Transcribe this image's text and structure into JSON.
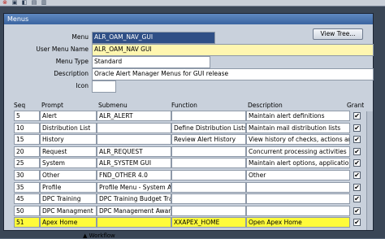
{
  "window": {
    "title": "Menus"
  },
  "toolbar": {
    "icons": [
      "close-icon",
      "save-icon",
      "nav-icon",
      "folder-icon",
      "print-icon"
    ]
  },
  "form": {
    "menu_label": "Menu",
    "menu_value": "ALR_OAM_NAV_GUI",
    "user_menu_name_label": "User Menu Name",
    "user_menu_name_value": "ALR_OAM_NAV GUI",
    "menu_type_label": "Menu Type",
    "menu_type_value": "Standard",
    "description_label": "Description",
    "description_value": "Oracle Alert Manager Menus for GUI release",
    "icon_label": "Icon",
    "icon_value": ""
  },
  "view_tree_button": "View Tree...",
  "table": {
    "headers": {
      "seq": "Seq",
      "prompt": "Prompt",
      "submenu": "Submenu",
      "function": "Function",
      "description": "Description",
      "grant": "Grant"
    },
    "rows": [
      {
        "seq": "5",
        "prompt": "Alert",
        "submenu": "ALR_ALERT",
        "function": "",
        "description": "Maintain alert definitions",
        "grant": true
      },
      {
        "seq": "10",
        "prompt": "Distribution List",
        "submenu": "",
        "function": "Define Distribution Lists",
        "description": "Maintain mail distribution lists",
        "grant": true
      },
      {
        "seq": "15",
        "prompt": "History",
        "submenu": "",
        "function": "Review Alert History",
        "description": "View history of checks, actions and",
        "grant": true
      },
      {
        "seq": "20",
        "prompt": "Request",
        "submenu": "ALR_REQUEST",
        "function": "",
        "description": "Concurrent processing activities",
        "grant": true
      },
      {
        "seq": "25",
        "prompt": "System",
        "submenu": "ALR_SYSTEM GUI",
        "function": "",
        "description": "Maintain alert options, applications,",
        "grant": true
      },
      {
        "seq": "30",
        "prompt": "Other",
        "submenu": "FND_OTHER 4.0",
        "function": "",
        "description": "Other",
        "grant": true
      },
      {
        "seq": "35",
        "prompt": "Profile",
        "submenu": "Profile Menu - System Ad",
        "function": "",
        "description": "",
        "grant": true
      },
      {
        "seq": "45",
        "prompt": "DPC Training",
        "submenu": "DPC Training Budget Trac",
        "function": "",
        "description": "",
        "grant": true
      },
      {
        "seq": "50",
        "prompt": "DPC Managment",
        "submenu": "DPC Management Award",
        "function": "",
        "description": "",
        "grant": true
      },
      {
        "seq": "51",
        "prompt": "Apex Home",
        "submenu": "",
        "function": "XXAPEX_HOME",
        "description": "Open Apex Home",
        "grant": true
      }
    ]
  },
  "bottom_text": "Workflow"
}
